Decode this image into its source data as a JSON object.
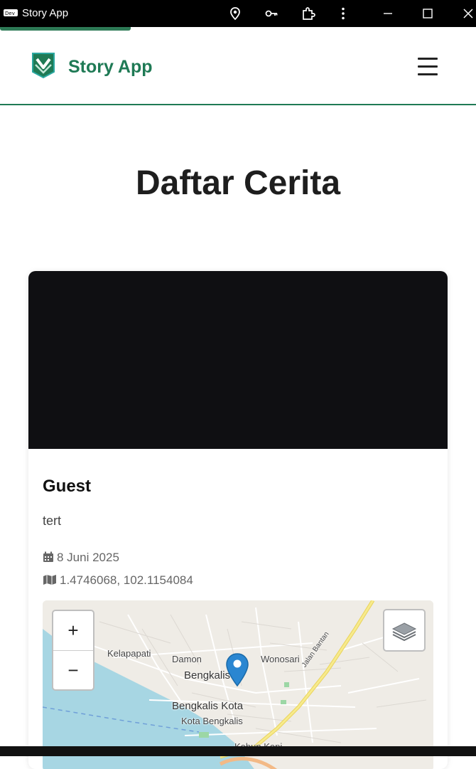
{
  "window": {
    "title": "Story App",
    "app_icon": "devtools-app-icon",
    "toolbar_icons": [
      "location-pin-icon",
      "key-icon",
      "extension-puzzle-icon",
      "kebab-menu-icon"
    ],
    "controls": [
      "minimize-icon",
      "maximize-icon",
      "close-icon"
    ]
  },
  "header": {
    "brand": "Story App",
    "logo": "story-app-logo",
    "menu_icon": "hamburger-menu-icon",
    "accent_color": "#1f7a55"
  },
  "main": {
    "title": "Daftar Cerita",
    "stories": [
      {
        "name": "Guest",
        "description": "tert",
        "date": "8 Juni 2025",
        "coordinates": "1.4746068, 102.1154084",
        "date_icon": "calendar-icon",
        "location_icon": "map-icon",
        "map": {
          "zoom_in": "+",
          "zoom_out": "−",
          "layers_icon": "layers-icon",
          "marker_icon": "map-marker-icon",
          "labels": [
            "Kelapapati",
            "Damon",
            "Bengkalis",
            "Wonosari",
            "Jalan Bantan",
            "Bengkalis Kota",
            "Kota Bengkalis",
            "Kebun Kopi"
          ]
        }
      }
    ]
  }
}
